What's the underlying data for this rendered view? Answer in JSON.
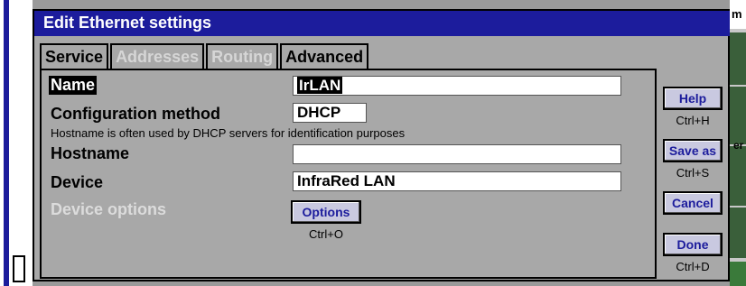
{
  "background": {
    "right_top_text": "m",
    "right_frag_text": "er"
  },
  "dialog": {
    "title": "Edit Ethernet settings"
  },
  "tabs": [
    {
      "label": "Service",
      "active": true
    },
    {
      "label": "Addresses",
      "active": false
    },
    {
      "label": "Routing",
      "active": false
    },
    {
      "label": "Advanced",
      "active": false
    }
  ],
  "form": {
    "name_label": "Name",
    "name_value": "IrLAN",
    "config_label": "Configuration method",
    "config_value": "DHCP",
    "hostname_note": "Hostname is often used by DHCP servers for identification purposes",
    "hostname_label": "Hostname",
    "hostname_value": "",
    "device_label": "Device",
    "device_value": "InfraRed LAN",
    "device_options_label": "Device options",
    "options_button": "Options",
    "options_shortcut": "Ctrl+O"
  },
  "actions": {
    "help": {
      "label": "Help",
      "shortcut": "Ctrl+H"
    },
    "save_as": {
      "label": "Save as",
      "shortcut": "Ctrl+S"
    },
    "cancel": {
      "label": "Cancel"
    },
    "done": {
      "label": "Done",
      "shortcut": "Ctrl+D"
    }
  },
  "colors": {
    "titlebar": "#1c1c9c",
    "button_text": "#1c1c9c",
    "dialog_bg": "#a8a8a8"
  }
}
